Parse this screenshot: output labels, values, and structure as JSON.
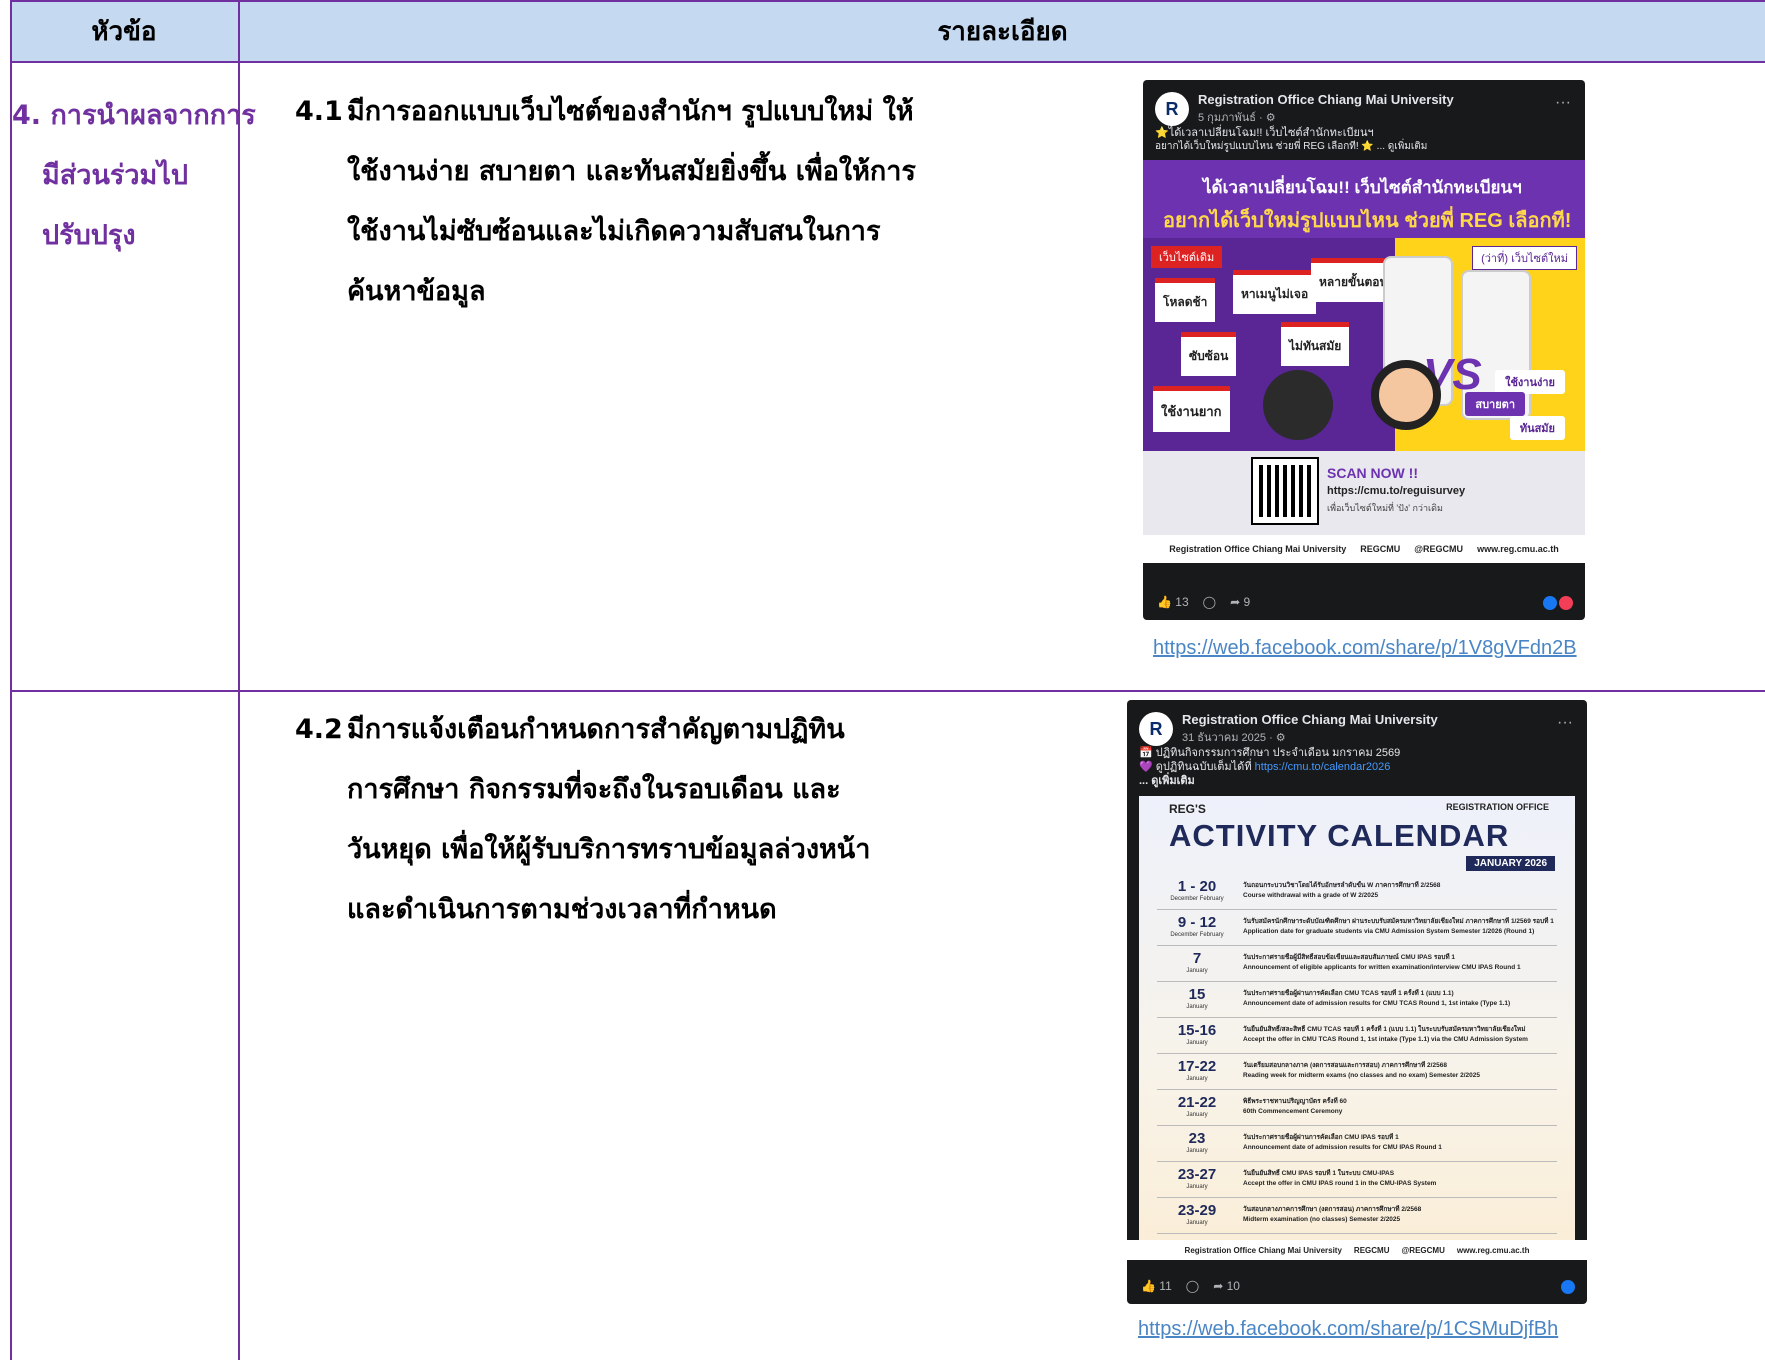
{
  "header": {
    "col1": "หัวข้อ",
    "col2": "รายละเอียด"
  },
  "topic": {
    "line1": "4. การนำผลจากการ",
    "line2": "มีส่วนร่วมไป",
    "line3": "ปรับปรุง"
  },
  "items": [
    {
      "num": "4.1",
      "lines": [
        "มีการออกแบบเว็บไซต์ของสำนักฯ รูปแบบใหม่ ให้",
        "ใช้งานง่าย สบายตา และทันสมัยยิ่งขึ้น เพื่อให้การ",
        "ใช้งานไม่ซับซ้อนและไม่เกิดความสับสนในการ",
        "ค้นหาข้อมูล"
      ],
      "link": "https://web.facebook.com/share/p/1V8gVFdn2B"
    },
    {
      "num": "4.2",
      "lines": [
        "มีการแจ้งเตือนกำหนดการสำคัญตามปฏิทิน",
        "การศึกษา กิจกรรมที่จะถึงในรอบเดือน และ",
        "วันหยุด เพื่อให้ผู้รับบริการทราบข้อมูลล่วงหน้า",
        "และดำเนินการตามช่วงเวลาที่กำหนด"
      ],
      "link": "https://web.facebook.com/share/p/1CSMuDjfBh"
    }
  ],
  "post1": {
    "page_name": "Registration Office Chiang Mai University",
    "date": "5 กุมภาพันธ์ · ⚙",
    "text1": "⭐ได้เวลาเปลี่ยนโฉม!! เว็บไซต์สำนักทะเบียนฯ",
    "text2": "อยากได้เว็บใหม่รูปแบบไหน ช่วยพี่ REG เลือกที! ⭐ ... ดูเพิ่มเติม",
    "poster_title": "ได้เวลาเปลี่ยนโฉม!! เว็บไซต์สำนักทะเบียนฯ",
    "poster_subtitle": "อยากได้เว็บใหม่รูปแบบไหน ช่วยพี่ REG เลือกที!",
    "old_label": "เว็บไซต์เดิม",
    "new_label": "(ว่าที่) เว็บไซต์ใหม่",
    "old_tags": [
      "โหลดช้า",
      "หาเมนูไม่เจอ",
      "หลายขั้นตอน",
      "ซับซ้อน",
      "ไม่ทันสมัย",
      "ใช้งานยาก"
    ],
    "new_tags": [
      "ใช้งานง่าย",
      "สบายตา",
      "ทันสมัย"
    ],
    "vs": "VS",
    "scan_title": "SCAN NOW !!",
    "scan_url": "https://cmu.to/reguisurvey",
    "scan_note": "เพื่อเว็บไซต์ใหม่ที่ 'ปัง' กว่าเดิม",
    "socials": [
      "Registration Office Chiang Mai University",
      "REGCMU",
      "@REGCMU",
      "www.reg.cmu.ac.th"
    ],
    "likes": "13",
    "shares": "9"
  },
  "post2": {
    "page_name": "Registration Office Chiang Mai University",
    "date": "31 ธันวาคม 2025 · ⚙",
    "text1": "📅 ปฏิทินกิจกรรมการศึกษา ประจำเดือน มกราคม 2569",
    "text2_prefix": "💜 ดูปฏิทินฉบับเต็มได้ที่ ",
    "text2_link": "https://cmu.to/calendar2026",
    "text3": "... ดูเพิ่มเติม",
    "brand": "REG'S",
    "logo": "REGISTRATION OFFICE",
    "title": "ACTIVITY CALENDAR",
    "month": "JANUARY 2026",
    "rows": [
      {
        "day": "1 - 20",
        "sub": "December  February",
        "th": "วันถอนกระบวนวิชาโดยได้รับอักษรลำดับขั้น W ภาคการศึกษาที่ 2/2568",
        "en": "Course withdrawal with a grade of W 2/2025"
      },
      {
        "day": "9 - 12",
        "sub": "December  February",
        "th": "วันรับสมัครนักศึกษาระดับบัณฑิตศึกษา ผ่านระบบรับสมัครมหาวิทยาลัยเชียงใหม่ ภาคการศึกษาที่ 1/2569 รอบที่ 1",
        "en": "Application date for graduate students via CMU Admission System Semester 1/2026 (Round 1)"
      },
      {
        "day": "7",
        "sub": "January",
        "th": "วันประกาศรายชื่อผู้มีสิทธิ์สอบข้อเขียนและสอบสัมภาษณ์ CMU IPAS รอบที่ 1",
        "en": "Announcement of eligible applicants for written examination/interview CMU IPAS Round 1"
      },
      {
        "day": "15",
        "sub": "January",
        "th": "วันประกาศรายชื่อผู้ผ่านการคัดเลือก CMU TCAS รอบที่ 1 ครั้งที่ 1 (แบบ 1.1)",
        "en": "Announcement date of admission results for CMU TCAS Round 1, 1st intake (Type 1.1)"
      },
      {
        "day": "15-16",
        "sub": "January",
        "th": "วันยืนยันสิทธิ์/สละสิทธิ์ CMU TCAS รอบที่ 1 ครั้งที่ 1 (แบบ 1.1) ในระบบรับสมัครมหาวิทยาลัยเชียงใหม่",
        "en": "Accept the offer in CMU TCAS Round 1, 1st intake (Type 1.1) via the CMU Admission System"
      },
      {
        "day": "17-22",
        "sub": "January",
        "th": "วันเตรียมสอบกลางภาค (งดการสอนและการสอบ) ภาคการศึกษาที่ 2/2568",
        "en": "Reading week for midterm exams (no classes and no exam) Semester 2/2025"
      },
      {
        "day": "21-22",
        "sub": "January",
        "th": "พิธีพระราชทานปริญญาบัตร ครั้งที่ 60",
        "en": "60th Commencement Ceremony"
      },
      {
        "day": "23",
        "sub": "January",
        "th": "วันประกาศรายชื่อผู้ผ่านการคัดเลือก CMU IPAS รอบที่ 1",
        "en": "Announcement date of admission results for CMU IPAS Round 1"
      },
      {
        "day": "23-27",
        "sub": "January",
        "th": "วันยืนยันสิทธิ์ CMU IPAS รอบที่ 1 ในระบบ CMU-IPAS",
        "en": "Accept the offer in CMU IPAS round 1 in the CMU-IPAS System"
      },
      {
        "day": "23-29",
        "sub": "January",
        "th": "วันสอบกลางภาคการศึกษา (งดการสอน) ภาคการศึกษาที่ 2/2568",
        "en": "Midterm examination (no classes) Semester 2/2025"
      }
    ],
    "socials": [
      "Registration Office Chiang Mai University",
      "REGCMU",
      "@REGCMU",
      "www.reg.cmu.ac.th"
    ],
    "likes": "11",
    "shares": "10"
  },
  "colors": {
    "accent": "#7030a0",
    "header_bg": "#c5d9f1",
    "link": "#4a86c5"
  }
}
